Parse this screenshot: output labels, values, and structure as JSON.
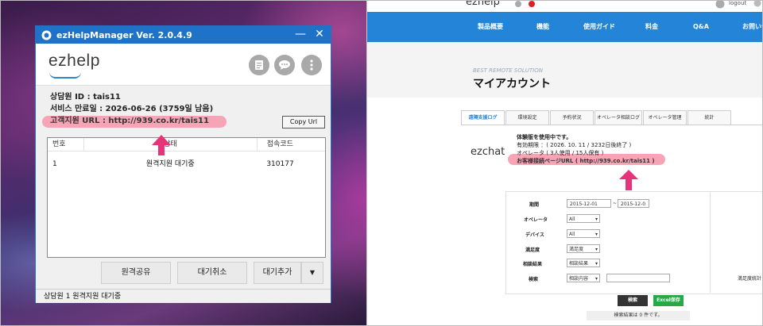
{
  "left": {
    "app_title": "ezHelpManager Ver. 2.0.4.9",
    "min_label": "—",
    "close_label": "✕",
    "logo_text": "ezhelp",
    "header_icons": [
      "document-icon",
      "chat-icon",
      "more-icon"
    ],
    "agent_id": "상담원 ID : tais11",
    "expiry": "서비스 만료일 : 2026-06-26 (3759일 남음)",
    "customer_url": "고객지원 URL : http://939.co.kr/tais11",
    "copy_url_label": "Copy Url",
    "table": {
      "headers": [
        "번호",
        "상태",
        "접속코드"
      ],
      "rows": [
        [
          "1",
          "원격지원 대기중",
          "310177"
        ]
      ]
    },
    "buttons": {
      "share": "원격공유",
      "cancel": "대기취소",
      "add": "대기추가",
      "dropdown": "▼"
    },
    "status_bar": "상담원 1 원격지원 대기중",
    "colors": {
      "titlebar": "#1e73c8",
      "highlight": "#f7a5b6",
      "arrow": "#e8327a"
    }
  },
  "right": {
    "logo_text": "ezhelp",
    "logout_label": "logout",
    "nav": [
      "製品概要",
      "機能",
      "使用ガイド",
      "料金",
      "Q&A",
      "お問い合"
    ],
    "subtitle": "BEST REMOTE SOLUTION",
    "page_title": "マイアカウント",
    "tabs": [
      "遠隔支援ログ",
      "環境設定",
      "予約状況",
      "オペレータ相談ログ",
      "オペレータ管理",
      "統計"
    ],
    "active_tab": "遠隔支援ログ",
    "brand": "ezchat",
    "info": {
      "line1": "体験版を使用中です。",
      "period": "有効期限 ：( 2026. 10. 11 / 3232日後終了 )",
      "operators": "オペレータ ( 3人使用 / 15人保有 )",
      "customer_url": "お客様接続ページURL ( http://939.co.kr/tais11 )"
    },
    "form": {
      "period_label": "期間",
      "date_from": "2015-12-01",
      "date_sep": "~",
      "date_to": "2015-12-0",
      "operator_label": "オペレータ",
      "operator_value": "All",
      "device_label": "デバイス",
      "device_value": "All",
      "satisfaction_label": "満足度",
      "satisfaction_value": "満足度",
      "result_label": "相談結果",
      "result_value": "相談結果",
      "search_label": "検索",
      "search_value": "相談内容",
      "side_link": "満足度統計"
    },
    "search_button": "検索",
    "excel_button": "Excel保存",
    "result_text": "検索結果は 0 件です。",
    "colors": {
      "nav": "#2485d8",
      "excel": "#2aa845",
      "search_btn": "#333333"
    }
  }
}
